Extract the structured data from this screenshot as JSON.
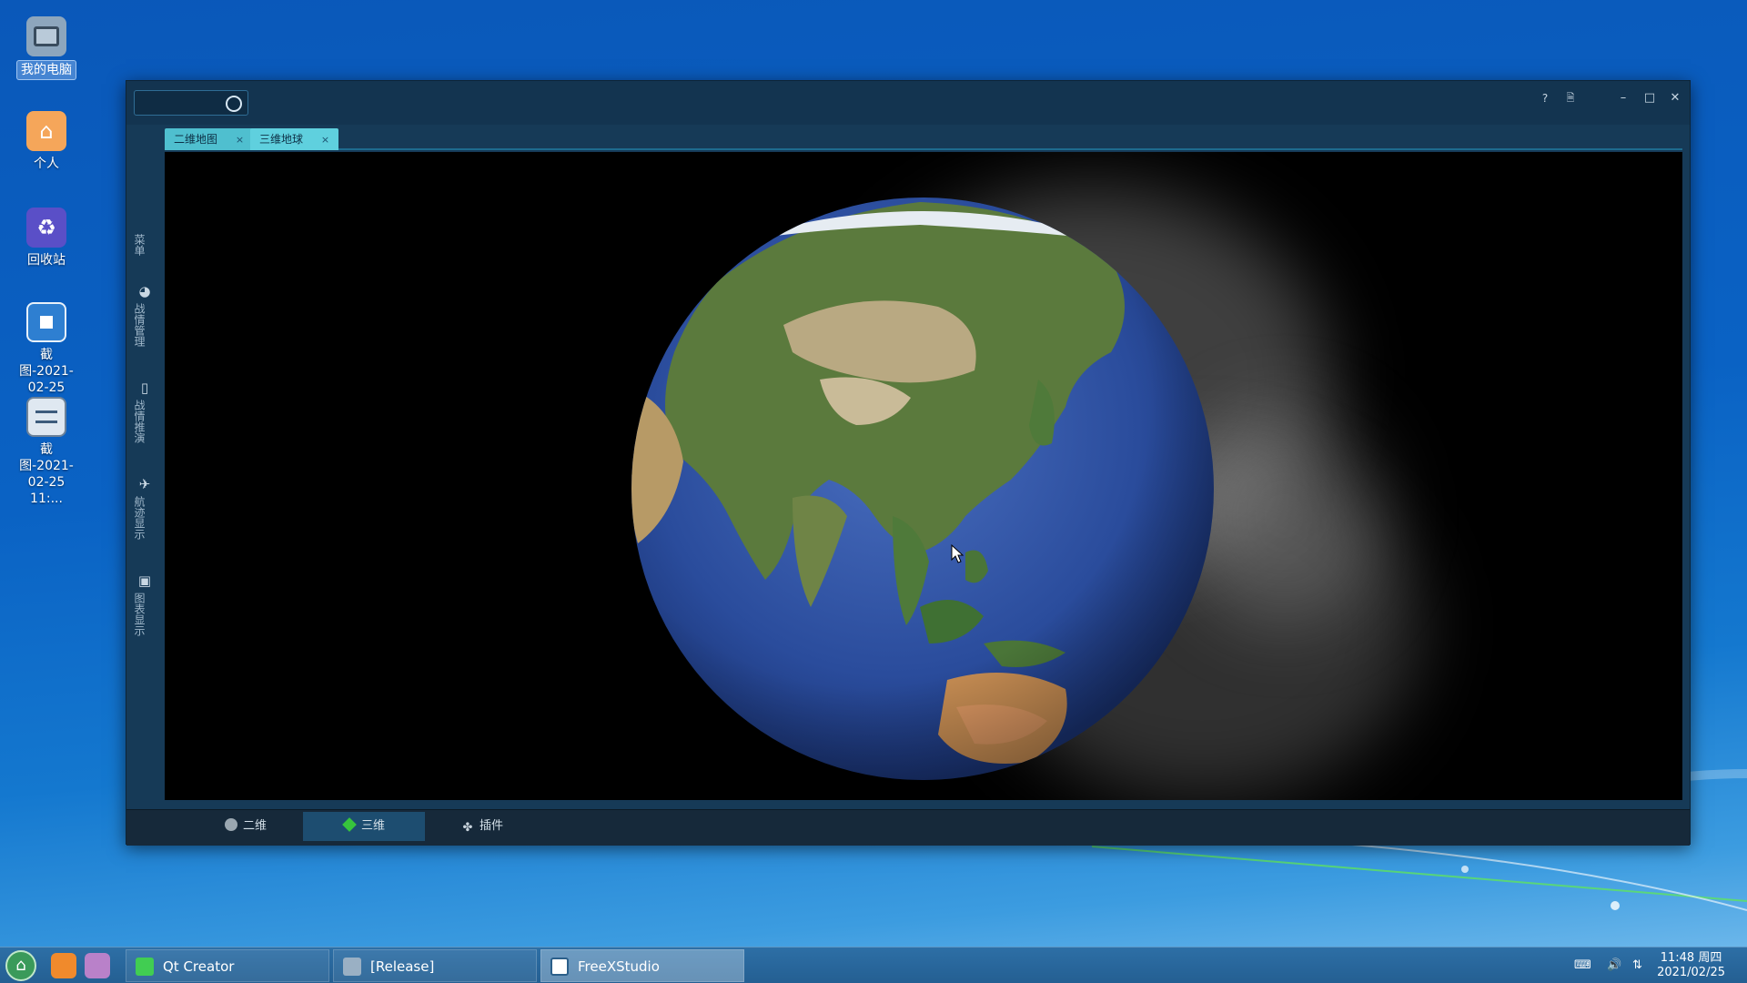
{
  "desktop": {
    "icons": [
      {
        "name": "my-computer",
        "label": "我的电脑",
        "selected": true
      },
      {
        "name": "personal-folder",
        "label": "个人"
      },
      {
        "name": "recycle-bin",
        "label": "回收站"
      },
      {
        "name": "screenshot-1",
        "label": "截图-2021-02-25 11:..."
      },
      {
        "name": "screenshot-2",
        "label": "截图-2021-02-25 11:..."
      }
    ]
  },
  "window": {
    "search_placeholder": "",
    "title_buttons": {
      "help": "?",
      "doc": "🗎",
      "minimize": "–",
      "maximize": "□",
      "close": "✕"
    },
    "sidebar": [
      {
        "label": "菜单",
        "icon": "menu-icon"
      },
      {
        "label": "战情管理",
        "icon": "pie-chart-icon"
      },
      {
        "label": "战情推演",
        "icon": "document-icon"
      },
      {
        "label": "航迹显示",
        "icon": "airplane-icon"
      },
      {
        "label": "图表显示",
        "icon": "image-icon"
      }
    ],
    "tabs": [
      {
        "label": "二维地图",
        "close": "×"
      },
      {
        "label": "三维地球",
        "close": "×",
        "active": true
      }
    ],
    "bottom_tabs": [
      {
        "label": "二维",
        "icon": "globe-icon"
      },
      {
        "label": "三维",
        "icon": "cube-icon",
        "active": true
      },
      {
        "label": "插件",
        "icon": "puzzle-icon"
      }
    ]
  },
  "taskbar": {
    "tasks": [
      {
        "label": "Qt Creator",
        "icon": "qt-icon"
      },
      {
        "label": "[Release]",
        "icon": "folder-icon"
      },
      {
        "label": "FreeXStudio",
        "icon": "window-icon",
        "active": true
      }
    ],
    "clock": {
      "time": "11:48 周四",
      "date": "2021/02/25"
    }
  },
  "colors": {
    "accent_tab": "#52c6d8",
    "window_bg": "#163a57",
    "desktop_blue": "#0a5fc2"
  }
}
